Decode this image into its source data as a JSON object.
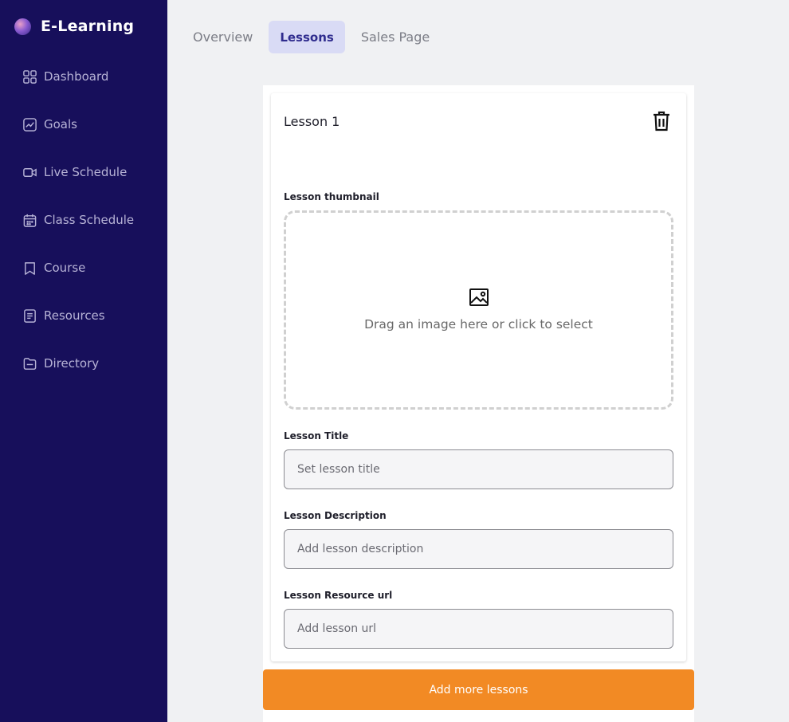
{
  "brand": {
    "title": "E-Learning"
  },
  "sidebar": {
    "items": [
      {
        "label": "Dashboard",
        "icon": "dashboard-grid-icon"
      },
      {
        "label": "Goals",
        "icon": "chart-trend-icon"
      },
      {
        "label": "Live Schedule",
        "icon": "video-camera-icon"
      },
      {
        "label": "Class Schedule",
        "icon": "calendar-icon"
      },
      {
        "label": "Course",
        "icon": "bookmark-icon"
      },
      {
        "label": "Resources",
        "icon": "document-icon"
      },
      {
        "label": "Directory",
        "icon": "folder-icon"
      }
    ]
  },
  "tabs": [
    {
      "label": "Overview",
      "active": false
    },
    {
      "label": "Lessons",
      "active": true
    },
    {
      "label": "Sales Page",
      "active": false
    }
  ],
  "lesson": {
    "heading": "Lesson 1",
    "thumbnail_label": "Lesson thumbnail",
    "dropzone_text": "Drag an image here or click to select",
    "title_label": "Lesson Title",
    "title_placeholder": "Set lesson title",
    "description_label": "Lesson Description",
    "description_placeholder": "Add lesson description",
    "url_label": "Lesson Resource url",
    "url_placeholder": "Add lesson url"
  },
  "add_button_label": "Add more lessons",
  "colors": {
    "sidebar_bg": "#170f5b",
    "accent_orange": "#f28a24",
    "active_tab_bg": "#d9dbf5",
    "active_tab_text": "#2f2c8e"
  }
}
